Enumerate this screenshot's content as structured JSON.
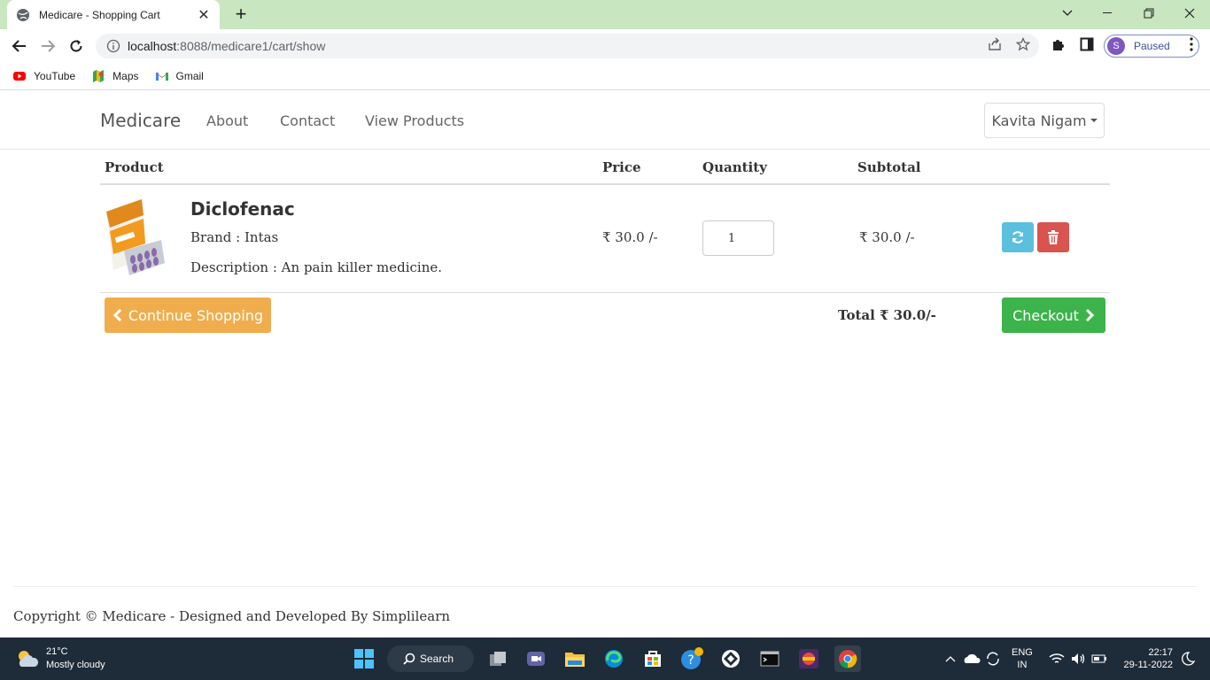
{
  "browser": {
    "tab_title": "Medicare - Shopping Cart",
    "url_host": "localhost",
    "url_path": ":8088/medicare1/cart/show",
    "profile_initial": "S",
    "profile_status": "Paused",
    "bookmarks": [
      "YouTube",
      "Maps",
      "Gmail"
    ]
  },
  "navbar": {
    "brand": "Medicare",
    "links": [
      "About",
      "Contact",
      "View Products"
    ],
    "user": "Kavita Nigam"
  },
  "cart": {
    "headers": {
      "product": "Product",
      "price": "Price",
      "quantity": "Quantity",
      "subtotal": "Subtotal"
    },
    "item": {
      "name": "Diclofenac",
      "brand": "Brand : Intas",
      "description": "Description : An pain killer medicine.",
      "price": "₹ 30.0 /-",
      "quantity": "1",
      "subtotal": "₹ 30.0 /-"
    },
    "continue_label": "Continue Shopping",
    "total": "Total ₹ 30.0/-",
    "checkout_label": "Checkout"
  },
  "footer": {
    "text": "Copyright © Medicare - Designed and Developed By Simplilearn"
  },
  "taskbar": {
    "temperature": "21°C",
    "weather": "Mostly cloudy",
    "search": "Search",
    "lang": "ENG",
    "region": "IN",
    "time": "22:17",
    "date": "29-11-2022"
  }
}
